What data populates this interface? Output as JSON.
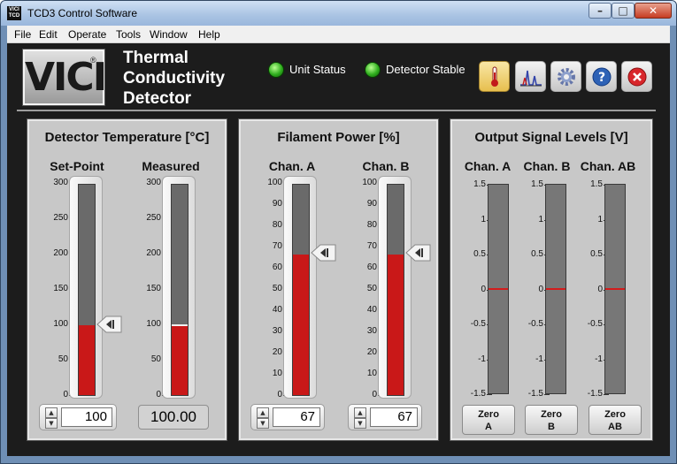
{
  "window": {
    "title": "TCD3 Control Software",
    "icon_text": "VICI TCD"
  },
  "menu": [
    "File",
    "Edit",
    "Operate",
    "Tools",
    "Window",
    "Help"
  ],
  "header": {
    "logo": "VICI",
    "logo_mark": "®",
    "title_lines": [
      "Thermal",
      "Conductivity",
      "Detector"
    ],
    "indicators": [
      {
        "label": "Unit Status",
        "color": "#2fae1e"
      },
      {
        "label": "Detector Stable",
        "color": "#2fae1e"
      }
    ],
    "toolbar_icons": [
      "thermometer-icon",
      "chromatogram-icon",
      "gear-icon",
      "help-icon",
      "close-icon"
    ]
  },
  "temperature": {
    "title": "Detector Temperature [°C]",
    "ticks": [
      "300",
      "250",
      "200",
      "150",
      "100",
      "50",
      "0"
    ],
    "range": [
      0,
      300
    ],
    "setpoint": {
      "label": "Set-Point",
      "value": 100,
      "display": "100"
    },
    "measured": {
      "label": "Measured",
      "value": 100,
      "display": "100.00"
    }
  },
  "filament": {
    "title": "Filament Power [%]",
    "ticks": [
      "100",
      "90",
      "80",
      "70",
      "60",
      "50",
      "40",
      "30",
      "20",
      "10",
      "0"
    ],
    "range": [
      0,
      100
    ],
    "channels": [
      {
        "label": "Chan. A",
        "value": 67,
        "display": "67"
      },
      {
        "label": "Chan. B",
        "value": 67,
        "display": "67"
      }
    ]
  },
  "output": {
    "title": "Output Signal Levels [V]",
    "ticks": [
      "1.5",
      "1",
      "0.5",
      "0",
      "-0.5",
      "-1",
      "-1.5"
    ],
    "range": [
      -1.5,
      1.5
    ],
    "channels": [
      {
        "label": "Chan. A",
        "value": 0,
        "zero": [
          "Zero",
          "A"
        ]
      },
      {
        "label": "Chan. B",
        "value": 0,
        "zero": [
          "Zero",
          "B"
        ]
      },
      {
        "label": "Chan. AB",
        "value": 0,
        "zero": [
          "Zero",
          "AB"
        ]
      }
    ]
  },
  "colors": {
    "fill": "#c91818",
    "led": "#2fae1e",
    "panel": "#c8c8c8",
    "background": "#1c1c1c"
  }
}
